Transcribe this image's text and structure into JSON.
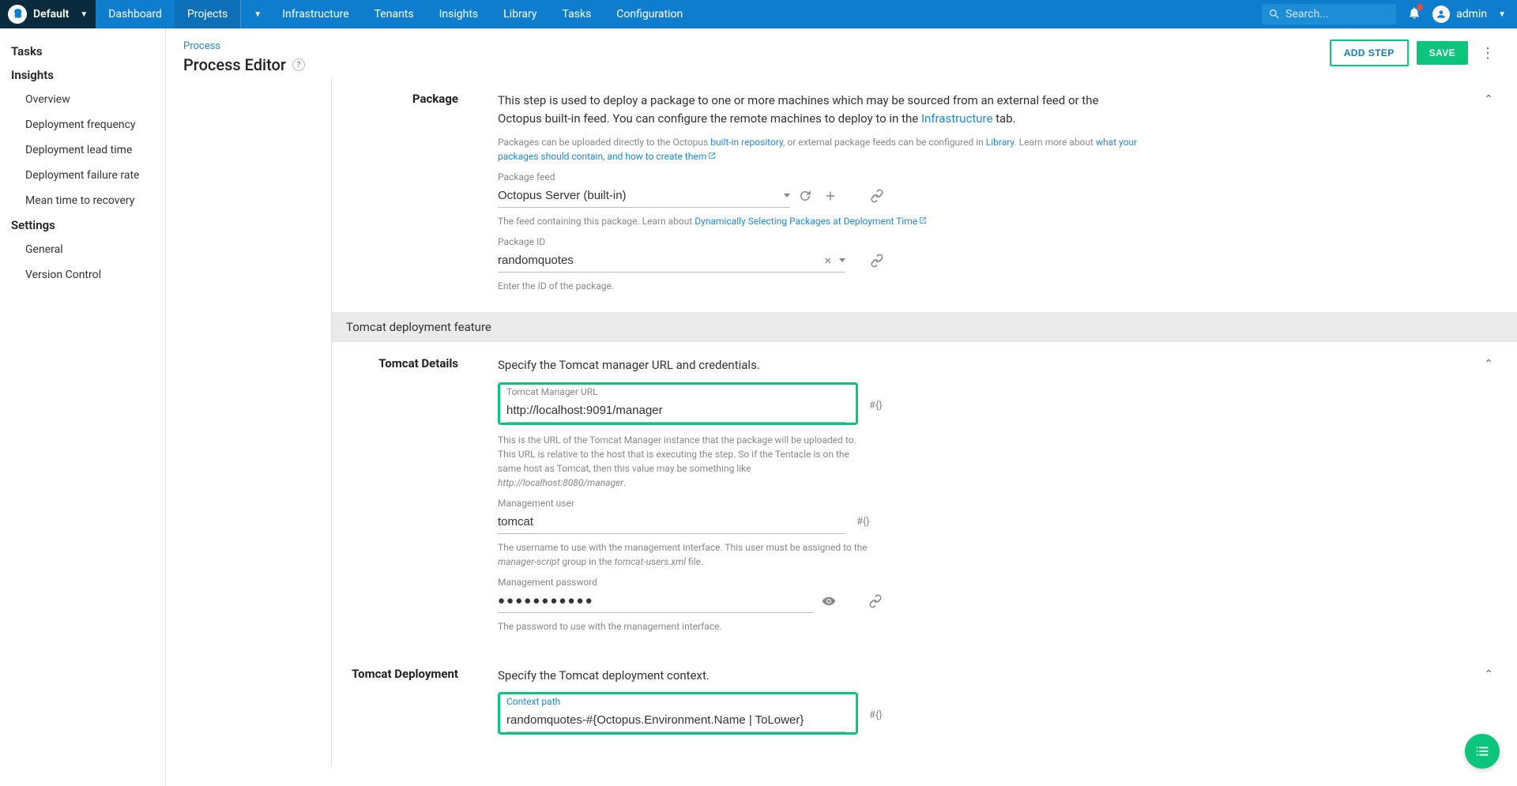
{
  "nav": {
    "brand": "Default",
    "items": [
      "Dashboard",
      "Projects",
      "Infrastructure",
      "Tenants",
      "Insights",
      "Library",
      "Tasks",
      "Configuration"
    ],
    "search_placeholder": "Search...",
    "user": "admin"
  },
  "sidebar": {
    "groups": [
      {
        "heading": "Tasks",
        "items": []
      },
      {
        "heading": "Insights",
        "items": [
          "Overview",
          "Deployment frequency",
          "Deployment lead time",
          "Deployment failure rate",
          "Mean time to recovery"
        ]
      },
      {
        "heading": "Settings",
        "items": [
          "General",
          "Version Control"
        ]
      }
    ]
  },
  "page": {
    "crumb": "Process",
    "title": "Process Editor",
    "add_step": "ADD STEP",
    "save": "SAVE"
  },
  "package": {
    "label": "Package",
    "desc_before": "This step is used to deploy a package to one or more machines which may be sourced from an external feed or the Octopus built-in feed. You can configure the remote machines to deploy to in the ",
    "desc_link": "Infrastructure",
    "desc_after": " tab.",
    "hint1_a": "Packages can be uploaded directly to the Octopus ",
    "hint1_link1": "built-in repository",
    "hint1_b": ", or external package feeds can be configured in ",
    "hint1_link2": "Library",
    "hint1_c": ". Learn more about ",
    "hint1_link3": "what your packages should contain, and how to create them",
    "feed_label": "Package feed",
    "feed_value": "Octopus Server (built-in)",
    "feed_hint_a": "The feed containing this package. Learn about ",
    "feed_hint_link": "Dynamically Selecting Packages at Deployment Time",
    "id_label": "Package ID",
    "id_value": "randomquotes",
    "id_hint": "Enter the ID of the package."
  },
  "section_tomcat_feature": "Tomcat deployment feature",
  "tomcat_details": {
    "label": "Tomcat Details",
    "desc": "Specify the Tomcat manager URL and credentials.",
    "url_label": "Tomcat Manager URL",
    "url_value": "http://localhost:9091/manager",
    "url_hint_a": "This is the URL of the Tomcat Manager instance that the package will be uploaded to. This URL is relative to the host that is executing the step. So if the Tentacle is on the same host as Tomcat, then this value may be something like ",
    "url_hint_i": "http://localhost:8080/manager",
    "user_label": "Management user",
    "user_value": "tomcat",
    "user_hint_a": "The username to use with the management interface. This user must be assigned to the ",
    "user_hint_i1": "manager-script",
    "user_hint_b": " group in the ",
    "user_hint_i2": "tomcat-users.xml",
    "user_hint_c": " file.",
    "pass_label": "Management password",
    "pass_value": "●●●●●●●●●●●",
    "pass_hint": "The password to use with the management interface."
  },
  "tomcat_deploy": {
    "label": "Tomcat Deployment",
    "desc": "Specify the Tomcat deployment context.",
    "ctx_label": "Context path",
    "ctx_value": "randomquotes-#{Octopus.Environment.Name | ToLower}"
  },
  "var_token": "#{}"
}
